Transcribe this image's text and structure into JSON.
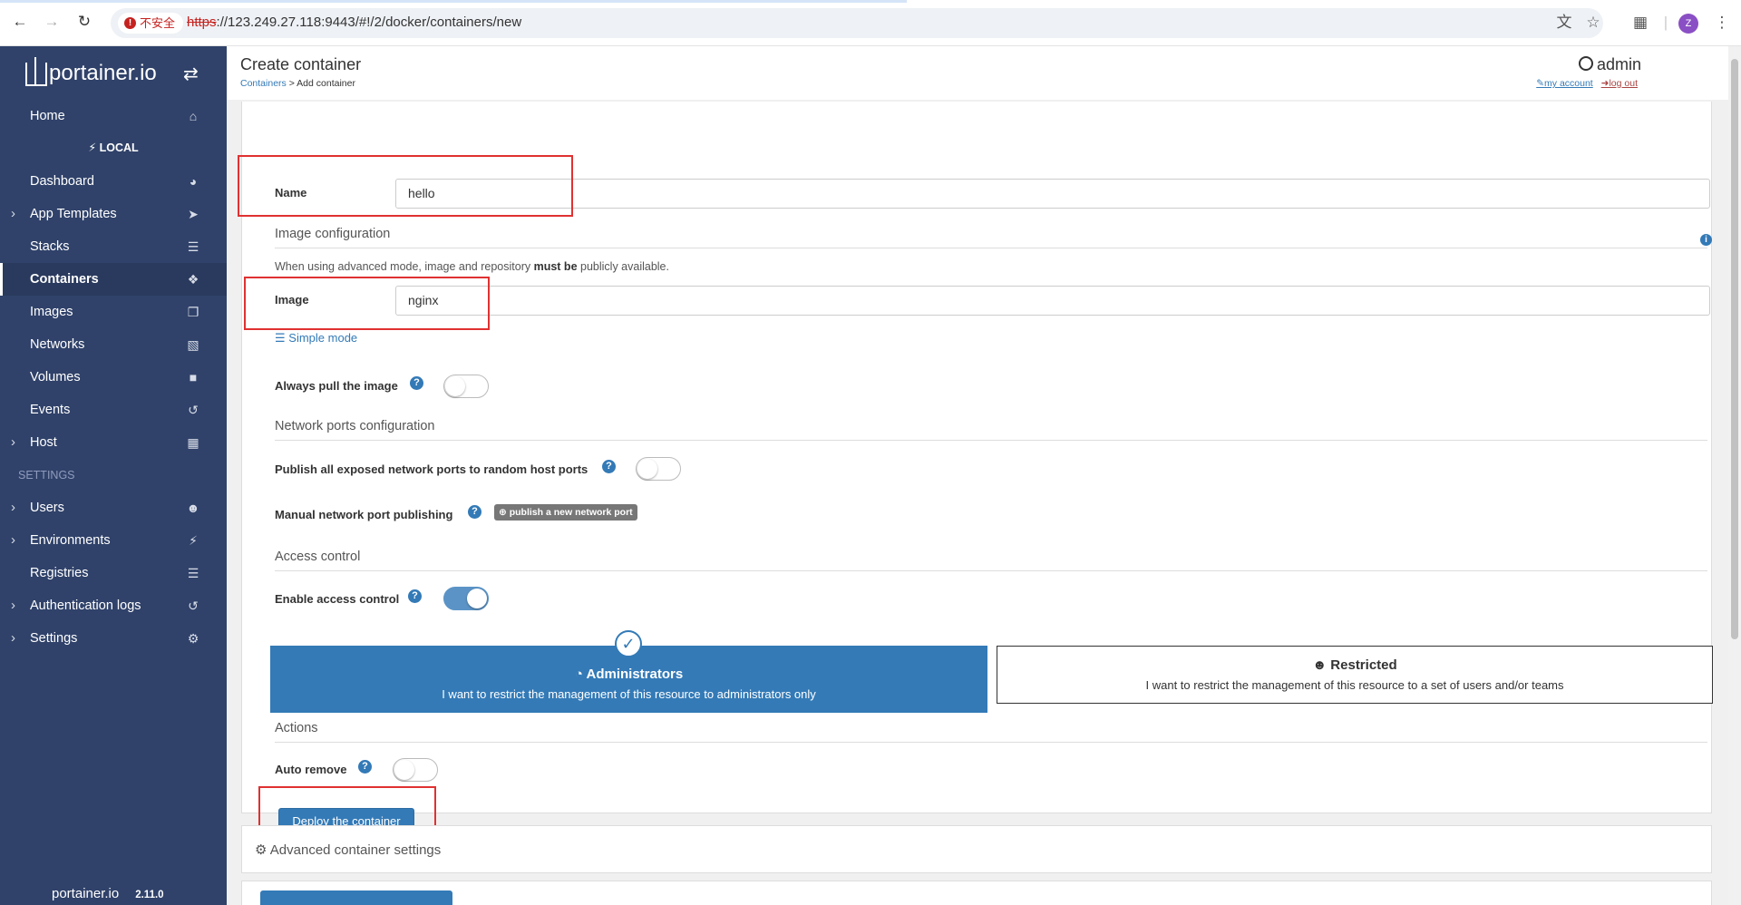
{
  "browser": {
    "back_icon": "arrow-left",
    "forward_icon": "arrow-right",
    "reload_icon": "reload",
    "security_label": "不安全",
    "url_protocol": "https",
    "url_rest": "://123.249.27.118:9443/#!/2/docker/containers/new",
    "profile_initial": "Z"
  },
  "sidebar": {
    "logo_text": "portainer.io",
    "environment_label": "LOCAL",
    "settings_header": "SETTINGS",
    "items": [
      {
        "label": "Home",
        "icon": "home-icon"
      },
      {
        "label": "Dashboard",
        "icon": "tachometer-icon"
      },
      {
        "label": "App Templates",
        "icon": "rocket-icon"
      },
      {
        "label": "Stacks",
        "icon": "th-list-icon"
      },
      {
        "label": "Containers",
        "icon": "cubes-icon"
      },
      {
        "label": "Images",
        "icon": "clone-icon"
      },
      {
        "label": "Networks",
        "icon": "sitemap-icon"
      },
      {
        "label": "Volumes",
        "icon": "hdd-icon"
      },
      {
        "label": "Events",
        "icon": "history-icon"
      },
      {
        "label": "Host",
        "icon": "th-icon"
      },
      {
        "label": "Users",
        "icon": "users-icon"
      },
      {
        "label": "Environments",
        "icon": "plug-icon"
      },
      {
        "label": "Registries",
        "icon": "database-icon"
      },
      {
        "label": "Authentication logs",
        "icon": "history-icon"
      },
      {
        "label": "Settings",
        "icon": "cogs-icon"
      }
    ],
    "footer_logo": "portainer.io",
    "version": "2.11.0"
  },
  "header": {
    "title": "Create container",
    "breadcrumb_link": "Containers",
    "breadcrumb_rest": " > Add container",
    "username": "admin",
    "my_account": "my account",
    "log_out": "log out"
  },
  "form": {
    "name_label": "Name",
    "name_value": "hello",
    "image_section": "Image configuration",
    "image_note_pre": "When using advanced mode, image and repository ",
    "image_note_bold": "must be",
    "image_note_post": " publicly available.",
    "image_label": "Image",
    "image_value": "nginx",
    "simple_mode": "Simple mode",
    "always_pull_label": "Always pull the image",
    "always_pull_on": false,
    "network_section": "Network ports configuration",
    "publish_all_label": "Publish all exposed network ports to random host ports",
    "publish_all_on": false,
    "manual_publish_label": "Manual network port publishing",
    "publish_btn": "publish a new network port",
    "access_section": "Access control",
    "enable_access_label": "Enable access control",
    "enable_access_on": true,
    "admin_title": "Administrators",
    "admin_desc": "I want to restrict the management of this resource to administrators only",
    "restricted_title": "Restricted",
    "restricted_desc": "I want to restrict the management of this resource to a set of users and/or teams",
    "actions_section": "Actions",
    "auto_remove_label": "Auto remove",
    "auto_remove_on": false,
    "deploy_btn": "Deploy the container"
  },
  "advanced": {
    "title": "Advanced container settings"
  },
  "colors": {
    "sidebar_bg": "#30426a",
    "primary": "#337ab7",
    "highlight_red": "#e03131"
  }
}
